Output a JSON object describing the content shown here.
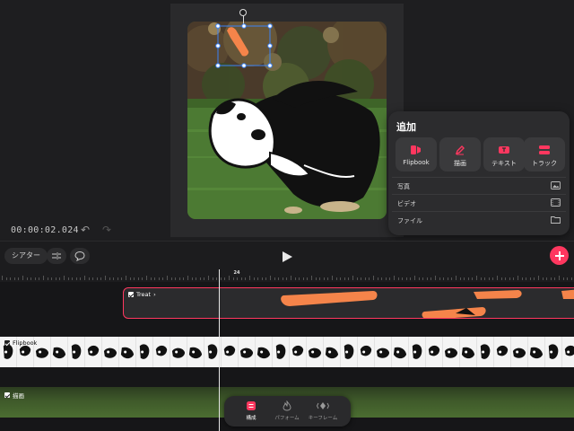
{
  "colors": {
    "accent": "#ff375f",
    "treat": "#f5844a",
    "background": "#1c1c1e"
  },
  "preview": {
    "timecode": "00:00:02.024",
    "undo_icon": "undo-icon",
    "redo_icon": "redo-icon"
  },
  "add_panel": {
    "title": "追加",
    "tiles": [
      {
        "label": "Flipbook",
        "icon": "flipbook-icon"
      },
      {
        "label": "描画",
        "icon": "pen-icon"
      },
      {
        "label": "テキスト",
        "icon": "text-icon"
      },
      {
        "label": "トラック",
        "icon": "track-icon"
      }
    ],
    "rows": [
      {
        "label": "写真",
        "icon": "photo-icon"
      },
      {
        "label": "ビデオ",
        "icon": "video-icon"
      },
      {
        "label": "ファイル",
        "icon": "folder-icon"
      }
    ]
  },
  "toolbar": {
    "theater_label": "シアター",
    "split_icon": "split-icon",
    "comment_icon": "comment-icon",
    "play_icon": "play-icon",
    "add_icon": "plus-icon"
  },
  "ruler": {
    "current_label": "24"
  },
  "tracks": {
    "treat": {
      "label": "Treat",
      "chevron": "›"
    },
    "flipbook": {
      "label": "Flipbook"
    },
    "drawing": {
      "label": "描画"
    }
  },
  "modes": [
    {
      "label": "構成",
      "icon": "compose-icon",
      "active": true
    },
    {
      "label": "パフォーム",
      "icon": "flame-icon",
      "active": false
    },
    {
      "label": "キーフレーム",
      "icon": "keyframe-icon",
      "active": false
    }
  ]
}
